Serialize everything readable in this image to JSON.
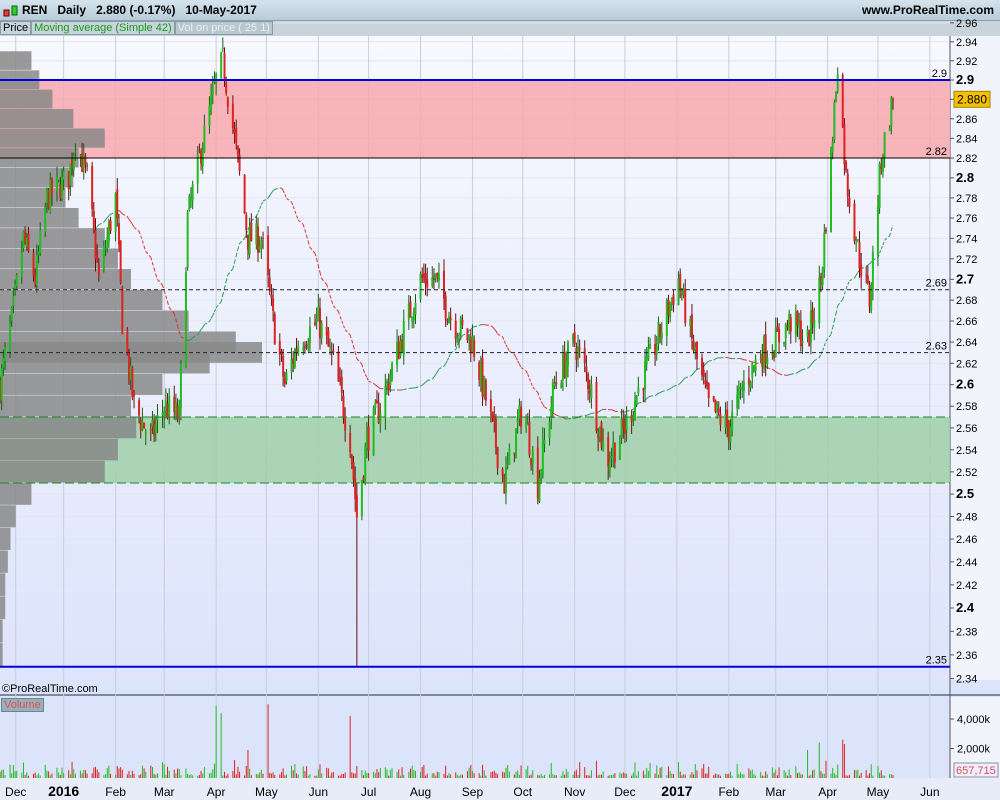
{
  "header": {
    "symbol": "REN",
    "period": "Daily",
    "price": "2.880",
    "change": "(-0.17%)",
    "date": "10-May-2017",
    "site": "www.ProRealTime.com"
  },
  "tabs": [
    "Price",
    "Moving average (Simple 42)",
    "Vol on price ( 25 1)"
  ],
  "copyright": "©ProRealTime.com",
  "volume_label": "Volume",
  "colors": {
    "up": "#22bb22",
    "down": "#dd2222",
    "resistance_zone": "#f7a8ae",
    "support_zone": "#9fd0a8",
    "level_line": "#0000dd",
    "price_tag": "#f5c000",
    "plot_bg": "#f2f4fc",
    "volume_profile": "#888888"
  },
  "chart_data": {
    "type": "candlestick",
    "scale": "log",
    "ylim": [
      2.33,
      2.97
    ],
    "y_ticks": [
      "2.96",
      "2.94",
      "2.92",
      "2.9",
      "2.88",
      "2.86",
      "2.84",
      "2.82",
      "2.8",
      "2.78",
      "2.76",
      "2.74",
      "2.72",
      "2.7",
      "2.68",
      "2.66",
      "2.64",
      "2.62",
      "2.6",
      "2.58",
      "2.56",
      "2.54",
      "2.52",
      "2.5",
      "2.48",
      "2.46",
      "2.44",
      "2.42",
      "2.4",
      "2.38",
      "2.36",
      "2.34"
    ],
    "x_labels": [
      "Dec",
      "2016",
      "Feb",
      "Mar",
      "Apr",
      "May",
      "Jun",
      "Jul",
      "Aug",
      "Sep",
      "Oct",
      "Nov",
      "Dec",
      "2017",
      "Feb",
      "Mar",
      "Apr",
      "May",
      "Jun"
    ],
    "x_label_dates": [
      "2015-12-01",
      "2016-01-01",
      "2016-02-01",
      "2016-03-01",
      "2016-04-01",
      "2016-05-01",
      "2016-06-01",
      "2016-07-01",
      "2016-08-01",
      "2016-09-01",
      "2016-10-01",
      "2016-11-01",
      "2016-12-01",
      "2017-01-01",
      "2017-02-01",
      "2017-03-01",
      "2017-04-01",
      "2017-05-01",
      "2017-06-01"
    ],
    "close_path": [
      [
        "2015-11-24",
        2.6
      ],
      [
        "2015-12-01",
        2.66
      ],
      [
        "2015-12-08",
        2.74
      ],
      [
        "2015-12-15",
        2.7
      ],
      [
        "2015-12-22",
        2.78
      ],
      [
        "2016-01-04",
        2.8
      ],
      [
        "2016-01-08",
        2.84
      ],
      [
        "2016-01-15",
        2.8
      ],
      [
        "2016-01-22",
        2.7
      ],
      [
        "2016-02-01",
        2.78
      ],
      [
        "2016-02-05",
        2.66
      ],
      [
        "2016-02-12",
        2.58
      ],
      [
        "2016-02-22",
        2.55
      ],
      [
        "2016-03-01",
        2.58
      ],
      [
        "2016-03-10",
        2.57
      ],
      [
        "2016-03-15",
        2.76
      ],
      [
        "2016-03-22",
        2.82
      ],
      [
        "2016-04-01",
        2.9
      ],
      [
        "2016-04-05",
        2.92
      ],
      [
        "2016-04-12",
        2.84
      ],
      [
        "2016-04-20",
        2.74
      ],
      [
        "2016-04-28",
        2.74
      ],
      [
        "2016-05-05",
        2.66
      ],
      [
        "2016-05-12",
        2.6
      ],
      [
        "2016-05-20",
        2.64
      ],
      [
        "2016-06-01",
        2.66
      ],
      [
        "2016-06-10",
        2.62
      ],
      [
        "2016-06-20",
        2.55
      ],
      [
        "2016-06-24",
        2.48
      ],
      [
        "2016-06-30",
        2.55
      ],
      [
        "2016-07-08",
        2.58
      ],
      [
        "2016-07-20",
        2.64
      ],
      [
        "2016-08-01",
        2.7
      ],
      [
        "2016-08-10",
        2.7
      ],
      [
        "2016-08-20",
        2.66
      ],
      [
        "2016-09-01",
        2.64
      ],
      [
        "2016-09-10",
        2.58
      ],
      [
        "2016-09-20",
        2.51
      ],
      [
        "2016-10-01",
        2.58
      ],
      [
        "2016-10-10",
        2.51
      ],
      [
        "2016-10-20",
        2.6
      ],
      [
        "2016-11-01",
        2.64
      ],
      [
        "2016-11-10",
        2.6
      ],
      [
        "2016-11-20",
        2.53
      ],
      [
        "2016-12-01",
        2.56
      ],
      [
        "2016-12-10",
        2.6
      ],
      [
        "2016-12-20",
        2.64
      ],
      [
        "2017-01-02",
        2.7
      ],
      [
        "2017-01-10",
        2.64
      ],
      [
        "2017-01-20",
        2.58
      ],
      [
        "2017-02-01",
        2.56
      ],
      [
        "2017-02-10",
        2.6
      ],
      [
        "2017-02-20",
        2.63
      ],
      [
        "2017-03-01",
        2.64
      ],
      [
        "2017-03-10",
        2.66
      ],
      [
        "2017-03-20",
        2.64
      ],
      [
        "2017-03-28",
        2.7
      ],
      [
        "2017-04-03",
        2.82
      ],
      [
        "2017-04-07",
        2.92
      ],
      [
        "2017-04-12",
        2.8
      ],
      [
        "2017-04-20",
        2.72
      ],
      [
        "2017-04-26",
        2.68
      ],
      [
        "2017-05-03",
        2.82
      ],
      [
        "2017-05-10",
        2.88
      ]
    ],
    "moving_average": {
      "type": "Simple",
      "period": 42
    },
    "levels": [
      {
        "value": 2.9,
        "label": "2.9",
        "style": "solid-blue"
      },
      {
        "value": 2.82,
        "label": "2.82",
        "style": "solid-dark"
      },
      {
        "value": 2.69,
        "label": "2.69",
        "style": "dashed-black"
      },
      {
        "value": 2.63,
        "label": "2.63",
        "style": "dashed-black"
      },
      {
        "value": 2.57,
        "label": "",
        "style": "dashed-green"
      },
      {
        "value": 2.51,
        "label": "",
        "style": "dashed-green"
      },
      {
        "value": 2.35,
        "label": "2.35",
        "style": "solid-blue"
      }
    ],
    "zones": [
      {
        "from": 2.82,
        "to": 2.9,
        "kind": "resistance"
      },
      {
        "from": 2.51,
        "to": 2.57,
        "kind": "support"
      }
    ],
    "volume_profile": [
      [
        2.92,
        0.12
      ],
      [
        2.9,
        0.15
      ],
      [
        2.88,
        0.2
      ],
      [
        2.86,
        0.28
      ],
      [
        2.84,
        0.4
      ],
      [
        2.82,
        0.3
      ],
      [
        2.8,
        0.28
      ],
      [
        2.78,
        0.25
      ],
      [
        2.76,
        0.3
      ],
      [
        2.74,
        0.4
      ],
      [
        2.72,
        0.45
      ],
      [
        2.7,
        0.5
      ],
      [
        2.68,
        0.62
      ],
      [
        2.66,
        0.72
      ],
      [
        2.64,
        0.9
      ],
      [
        2.63,
        1.0
      ],
      [
        2.62,
        0.8
      ],
      [
        2.6,
        0.62
      ],
      [
        2.58,
        0.5
      ],
      [
        2.56,
        0.52
      ],
      [
        2.54,
        0.45
      ],
      [
        2.52,
        0.4
      ],
      [
        2.5,
        0.12
      ],
      [
        2.48,
        0.06
      ],
      [
        2.46,
        0.04
      ],
      [
        2.44,
        0.03
      ],
      [
        2.42,
        0.02
      ],
      [
        2.4,
        0.02
      ],
      [
        2.38,
        0.01
      ],
      [
        2.36,
        0.01
      ]
    ],
    "volume": {
      "y_ticks": [
        "4,000k",
        "2,000k"
      ],
      "last": "657,715",
      "spikes": [
        [
          "2016-04-01",
          4900
        ],
        [
          "2016-04-04",
          4400
        ],
        [
          "2016-05-02",
          5000
        ],
        [
          "2016-06-20",
          4200
        ],
        [
          "2017-03-27",
          2400
        ],
        [
          "2017-04-10",
          2600
        ],
        [
          "2017-04-11",
          2300
        ],
        [
          "2016-04-20",
          1900
        ],
        [
          "2017-03-20",
          1900
        ]
      ]
    }
  }
}
